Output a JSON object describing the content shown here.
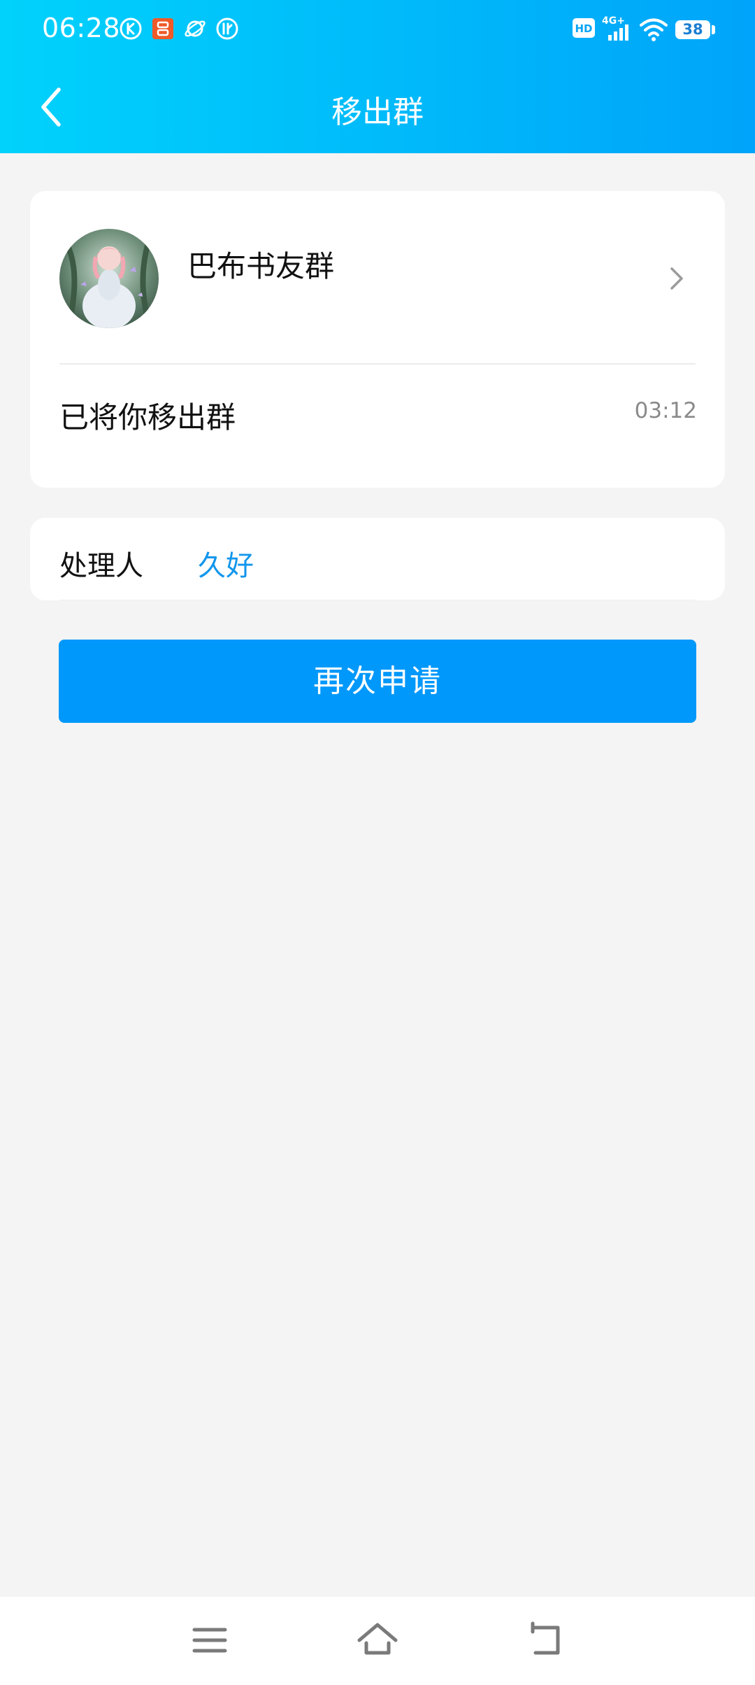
{
  "status_bar": {
    "time": "06:28",
    "battery": "38",
    "network": "4G+",
    "hd": "HD"
  },
  "header": {
    "title": "移出群"
  },
  "group": {
    "name": "巴布书友群",
    "message": "已将你移出群",
    "time": "03:12"
  },
  "handler": {
    "label": "处理人",
    "name": "久好"
  },
  "actions": {
    "apply_again": "再次申请"
  },
  "colors": {
    "header_start": "#00d2fb",
    "header_end": "#00a4fa",
    "primary_button": "#0098fb",
    "link": "#1296ec"
  },
  "icons": {
    "back": "chevron-left-icon",
    "row_arrow": "chevron-right-icon",
    "nav_menu": "menu-icon",
    "nav_home": "home-icon",
    "nav_back": "return-icon"
  }
}
